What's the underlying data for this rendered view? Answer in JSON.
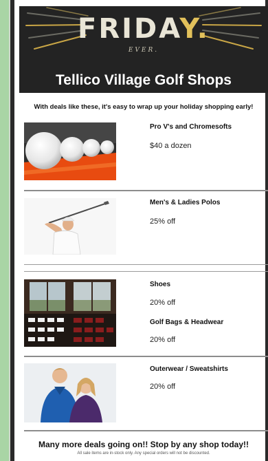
{
  "banner": {
    "headline_main": "FRIDA",
    "headline_accent": "Y.",
    "subline": "EVER.",
    "title": "Tellico Village Golf Shops"
  },
  "tagline": "With deals like these, it's easy to wrap up your holiday shopping early!",
  "products": [
    {
      "title": "Pro V's and Chromesofts",
      "offer": "$40 a dozen"
    },
    {
      "title": "Men's & Ladies Polos",
      "offer": "25% off"
    },
    {
      "title": "Shoes",
      "offer": "20% off"
    },
    {
      "title": "Golf Bags & Headwear",
      "offer": "20% off"
    },
    {
      "title": "Outerwear / Sweatshirts",
      "offer": "20% off"
    }
  ],
  "footer": {
    "headline": "Many more deals going on!! Stop by any shop today!!",
    "note": "All sale items are in-stock only. Any special orders will not be discounted."
  },
  "colors": {
    "banner_bg": "#232323",
    "accent_gold": "#e2c15b",
    "side_strip": "#a9d5a5"
  }
}
